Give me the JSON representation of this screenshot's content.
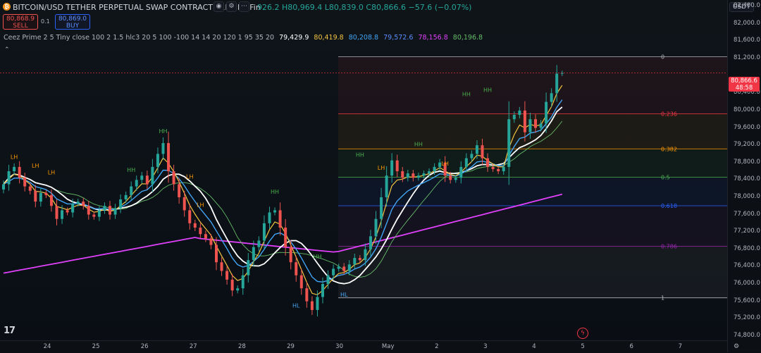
{
  "header": {
    "pair": "BITCOIN/USD TETHER PERPETUAL SWAP CONTRACT · 1h · BloFin",
    "ohlc": "926.2 H80,969.4 L80,839.0 C80,866.6 −57.6 (−0.07%)",
    "sell_price": "80,868.9",
    "sell_label": "SELL",
    "spread": "0.1",
    "buy_price": "80,869.0",
    "buy_label": "BUY"
  },
  "indicator": {
    "name": "Ceez Prime 2 5 Tiny close 100 2 1.5 hlc3 20 5 100 -100 14 14 20 120 1 95 35 20",
    "values": [
      {
        "text": "79,429.9",
        "color": "#ffffff"
      },
      {
        "text": "80,419.8",
        "color": "#f5c542"
      },
      {
        "text": "80,208.8",
        "color": "#42a5f5"
      },
      {
        "text": "79,572.6",
        "color": "#5c8dff"
      },
      {
        "text": "78,156.8",
        "color": "#e040fb"
      },
      {
        "text": "80,196.8",
        "color": "#66bb6a"
      }
    ]
  },
  "axis": {
    "currency": "USDT",
    "price_labels": [
      "82,400.0",
      "82,000.0",
      "81,600.0",
      "81,200.0",
      "80,400.0",
      "80,000.0",
      "79,600.0",
      "79,200.0",
      "78,800.0",
      "78,400.0",
      "78,000.0",
      "77,600.0",
      "77,200.0",
      "76,800.0",
      "76,400.0",
      "76,000.0",
      "75,600.0",
      "75,200.0",
      "74,800.0"
    ],
    "current_price": "80,866.6",
    "countdown": "48:58",
    "date_labels": [
      "24",
      "25",
      "26",
      "27",
      "28",
      "29",
      "30",
      "May",
      "2",
      "3",
      "4",
      "5",
      "6",
      "7"
    ]
  },
  "chart_data": {
    "type": "candlestick",
    "price_range": [
      74700,
      82550
    ],
    "current_price": 80866.6,
    "fibonacci": {
      "high": 81240,
      "low": 75680,
      "levels": [
        {
          "ratio": 0,
          "label": "0",
          "color": "#b2b5be"
        },
        {
          "ratio": 0.236,
          "label": "0.236",
          "color": "#f23645"
        },
        {
          "ratio": 0.382,
          "label": "0.382",
          "color": "#ff9800"
        },
        {
          "ratio": 0.5,
          "label": "0.5",
          "color": "#4caf50"
        },
        {
          "ratio": 0.618,
          "label": "0.618",
          "color": "#2962ff"
        },
        {
          "ratio": 0.786,
          "label": "0.786",
          "color": "#9c27b0"
        },
        {
          "ratio": 1,
          "label": "1",
          "color": "#b2b5be"
        }
      ]
    },
    "closes": [
      78300,
      78600,
      78700,
      78450,
      78250,
      78150,
      77900,
      78100,
      78050,
      77800,
      77500,
      77700,
      77650,
      77850,
      77900,
      77800,
      77600,
      77550,
      77700,
      77800,
      77600,
      77750,
      77950,
      78050,
      78250,
      78400,
      78500,
      78300,
      78700,
      79000,
      79250,
      78600,
      78300,
      78000,
      77700,
      77400,
      77300,
      77150,
      77050,
      76900,
      76500,
      76300,
      76100,
      75850,
      75900,
      76200,
      76550,
      76850,
      77000,
      77400,
      77650,
      77700,
      77300,
      76850,
      76500,
      76200,
      75900,
      75600,
      75400,
      75700,
      76000,
      76200,
      76350,
      76400,
      76300,
      76450,
      76600,
      76550,
      76800,
      77100,
      77500,
      78000,
      78500,
      78850,
      78600,
      78450,
      78550,
      78450,
      78500,
      78550,
      78600,
      78700,
      78800,
      78500,
      78400,
      78450,
      78700,
      78900,
      79000,
      79200,
      78900,
      78700,
      78650,
      78600,
      78700,
      79800,
      79900,
      80000,
      79500,
      79800,
      79600,
      79700,
      80200,
      80400,
      80850,
      80866
    ],
    "pivots": [
      {
        "label": "LH",
        "i": 2,
        "price": 78800,
        "pos": "above",
        "color": "#ff9800"
      },
      {
        "label": "LH",
        "i": 6,
        "price": 78600,
        "pos": "above",
        "color": "#ff9800"
      },
      {
        "label": "LH",
        "i": 9,
        "price": 78450,
        "pos": "above",
        "color": "#ff9800"
      },
      {
        "label": "HH",
        "i": 24,
        "price": 78500,
        "pos": "above",
        "color": "#4caf50"
      },
      {
        "label": "HH",
        "i": 30,
        "price": 79400,
        "pos": "above",
        "color": "#4caf50"
      },
      {
        "label": "LH",
        "i": 35,
        "price": 78350,
        "pos": "above",
        "color": "#ff9800"
      },
      {
        "label": "LH",
        "i": 37,
        "price": 77700,
        "pos": "above",
        "color": "#ff9800"
      },
      {
        "label": "HH",
        "i": 51,
        "price": 78000,
        "pos": "above",
        "color": "#4caf50"
      },
      {
        "label": "HH",
        "i": 59,
        "price": 76500,
        "pos": "above",
        "color": "#4caf50"
      },
      {
        "label": "HH",
        "i": 67,
        "price": 78850,
        "pos": "above",
        "color": "#4caf50"
      },
      {
        "label": "LH",
        "i": 71,
        "price": 78550,
        "pos": "above",
        "color": "#ff9800"
      },
      {
        "label": "HH",
        "i": 78,
        "price": 79100,
        "pos": "above",
        "color": "#4caf50"
      },
      {
        "label": "LH",
        "i": 83,
        "price": 78650,
        "pos": "above",
        "color": "#ff9800"
      },
      {
        "label": "HH",
        "i": 87,
        "price": 80250,
        "pos": "above",
        "color": "#4caf50"
      },
      {
        "label": "HH",
        "i": 91,
        "price": 80350,
        "pos": "above",
        "color": "#4caf50"
      },
      {
        "label": "HL",
        "i": 55,
        "price": 75650,
        "pos": "below",
        "color": "#42a5f5"
      },
      {
        "label": "HL",
        "i": 64,
        "price": 75900,
        "pos": "below",
        "color": "#42a5f5"
      }
    ]
  }
}
